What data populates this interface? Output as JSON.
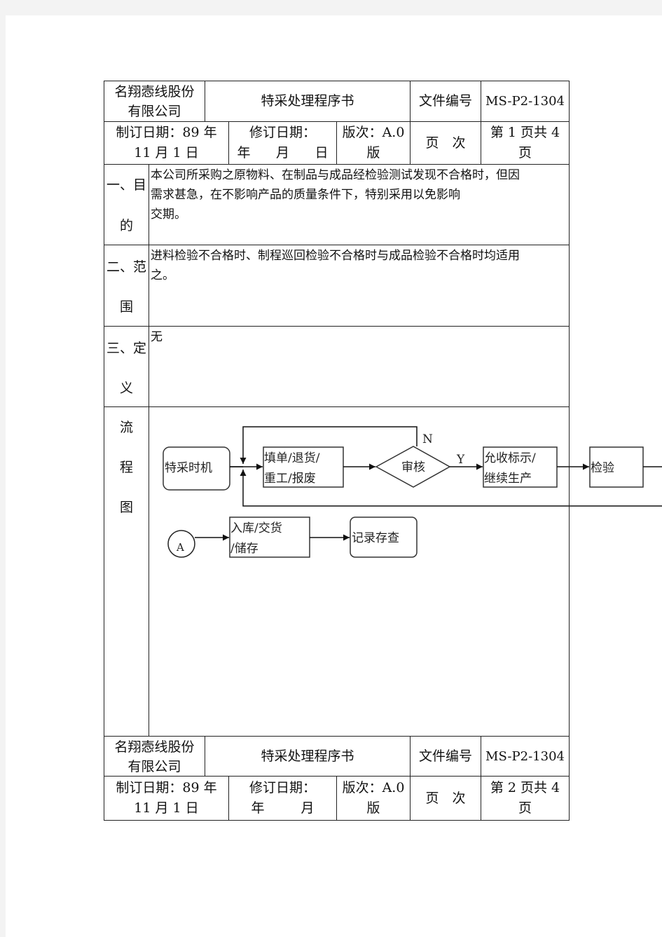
{
  "header": {
    "company": "名翔悫线股份有限公司",
    "company_line1": "名翔悫线股份",
    "company_line2": "有限公司",
    "doc_title": "特采处理程序书",
    "doc_no_label": "文件编号",
    "doc_no": "MS-P2-1304",
    "created_line1": "制订日期：89 年",
    "created_line2": "11 月 1 日",
    "revised_line1": "修订日期：",
    "revised_line2_y": "年",
    "revised_line2_m": "月",
    "revised_line2_d": "日",
    "version_line1": "版次：A.0",
    "version_line2": "版",
    "page_label": "页　次",
    "page_line1": "第 1 页共 4",
    "page_line2": "页"
  },
  "sections": [
    {
      "label_a": "一、目",
      "label_b": "的",
      "lines": [
        "本公司所采购之原物料、在制品与成品经检验测试发现不合格时，但因",
        "需求甚急，在不影响产品的质量条件下，特别采用以免影响",
        "交期。"
      ]
    },
    {
      "label_a": "二、范",
      "label_b": "围",
      "lines": [
        "进料检验不合格时、制程巡回检验不合格时与成品检验不合格时均适用",
        "之。"
      ]
    },
    {
      "label_a": "三、定",
      "label_b": "义",
      "lines": [
        "无"
      ]
    }
  ],
  "flow_section": {
    "label_1": "流",
    "label_2": "程",
    "label_3": "图"
  },
  "flowchart": {
    "start": "特采时机",
    "fill_line1": "填单/退货/",
    "fill_line2": "重工/报废",
    "review": "审核",
    "no_label": "N",
    "yes_label": "Y",
    "accept_line1": "允收标示/",
    "accept_line2": "继续生产",
    "inspect": "检验",
    "connector": "A",
    "store_line1": "入库/交货",
    "store_line2": "/储存",
    "record": "记录存查"
  },
  "footer_header": {
    "company_line1": "名翔悫线股份",
    "company_line2": "有限公司",
    "doc_title": "特采处理程序书",
    "doc_no_label": "文件编号",
    "doc_no": "MS-P2-1304",
    "created_line1": "制订日期：89 年",
    "created_line2": "11 月 1 日",
    "revised_line1": "修订日期：",
    "revised_line2_y": "年",
    "revised_line2_m": "月",
    "version_line1": "版次：A.0",
    "version_line2": "版",
    "page_label": "页　次",
    "page_line1": "第 2 页共 4",
    "page_line2": "页"
  }
}
